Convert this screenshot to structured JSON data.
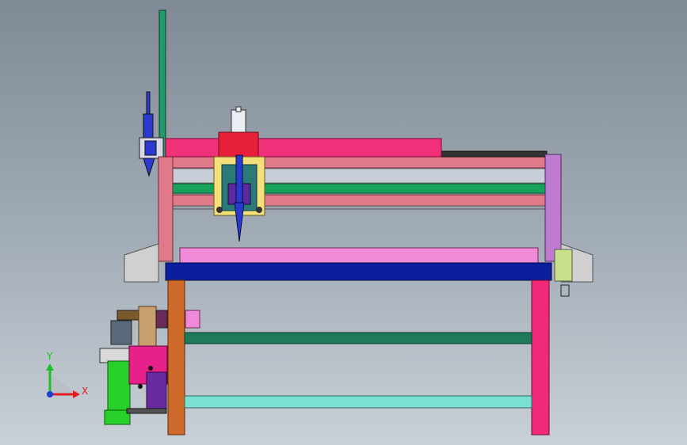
{
  "viewport": {
    "axis_triad": {
      "y_label": "Y",
      "x_label": "X",
      "y_color": "#1fbf2a",
      "x_color": "#e02020",
      "z_color": "#1f3fd6"
    }
  },
  "colors": {
    "background_top": "#7f8a96",
    "background_bottom": "#c9d0d7",
    "gantry_beam": "#f0317a",
    "frame_rail": "#e07a8a",
    "green_rail": "#17a35a",
    "table_top": "#f08ad8",
    "blue_beam": "#0b1f9e",
    "left_leg": "#d06a2a",
    "right_leg": "#f02a78",
    "lower_green_bar": "#1f7a5a",
    "lower_cyan_bar": "#7ae0d0",
    "tool_blue": "#2a3ad0",
    "carriage_yellow": "#f3e07a",
    "side_plate": "#c07ad0",
    "motor_green": "#2ad02a"
  }
}
